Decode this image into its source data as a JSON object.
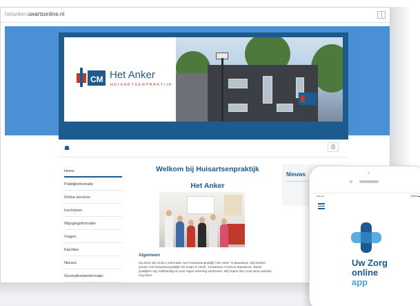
{
  "browser": {
    "url_prefix": "hetanker.",
    "url_domain": "uwartsonline.nl"
  },
  "site": {
    "logo_initials": "HCM",
    "logo_name": "Het Anker",
    "logo_subtitle": "HUISARTSENPRAKTIJK",
    "print_icon": "print-icon",
    "home_icon": "home-icon"
  },
  "menu": {
    "items": [
      {
        "label": "Home",
        "active": true
      },
      {
        "label": "Praktijkinformatie"
      },
      {
        "label": "Online services"
      },
      {
        "label": "Inschrijven"
      },
      {
        "label": "Wijzigingsformulier"
      },
      {
        "label": "Vragen"
      },
      {
        "label": "Klachten"
      },
      {
        "label": "Nieuws"
      },
      {
        "label": "Gezondheidsinformatie"
      }
    ]
  },
  "main": {
    "title": "Welkom bij Huisartsenpraktijk",
    "subtitle": "Het Anker",
    "section_heading": "Algemeen",
    "body": "Op deze site vindt u informatie over huisartsenpraktijk 'Het Anker' in Maassluis. Wij werken samen met huisartsenpraktijk 'De Kade' in HCM, 'Huisartsen Centrum Maassluis'. Beide praktijken zijn zelfstandig en voor eigen rekening werkzaam. Wij hopen dat u met deze website nog beter"
  },
  "sidebar": {
    "news_title": "Nieuws"
  },
  "phone": {
    "app_name_line1": "Uw Zorg",
    "app_name_line2": "online",
    "app_name_line3": "app",
    "status_left": "••••• ▲",
    "status_right": "100% ▬",
    "colors": {
      "app_text": "#1d5a8e",
      "app_accent": "#4aa3df"
    }
  }
}
